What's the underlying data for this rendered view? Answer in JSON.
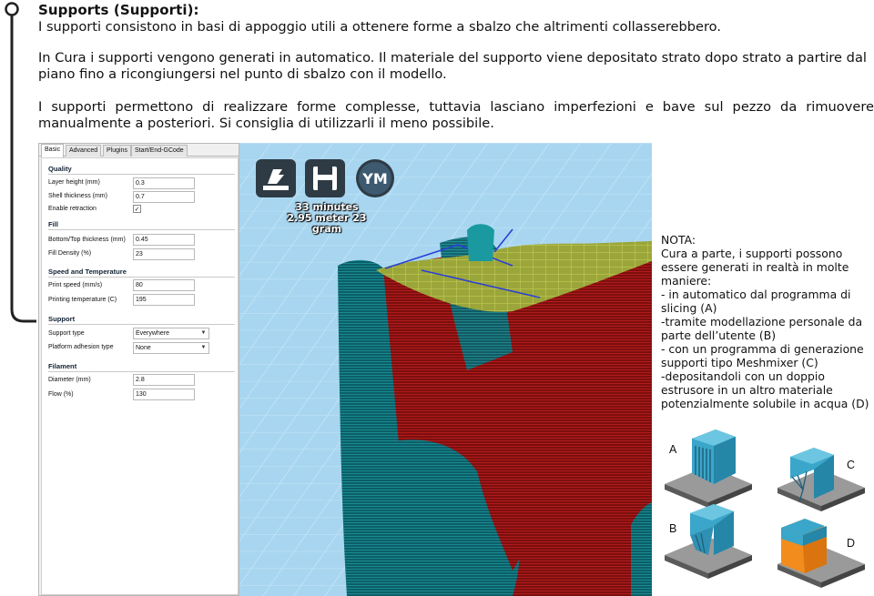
{
  "heading": "Supports (Supporti):",
  "paragraphs": [
    "I supporti consistono in basi di appoggio utili a ottenere forme a sbalzo che altrimenti collasserebbero.",
    "In Cura i supporti vengono generati in automatico. Il materiale del supporto viene depositato strato dopo strato a partire dal piano fino a ricongiungersi nel punto di sbalzo con il modello.",
    "I supporti permettono di realizzare forme complesse, tuttavia lasciano imperfezioni e bave sul pezzo da rimuovere manualmente a posteriori. Si consiglia di utilizzarli il meno possibile."
  ],
  "cura": {
    "tabs": [
      "Basic",
      "Advanced",
      "Plugins",
      "Start/End-GCode"
    ],
    "active_tab": "Basic",
    "sections": {
      "quality": "Quality",
      "fill": "Fill",
      "speed": "Speed and Temperature",
      "support": "Support",
      "filament": "Filament"
    },
    "fields": {
      "layer_height": {
        "label": "Layer height (mm)",
        "value": "0.3"
      },
      "shell_thickness": {
        "label": "Shell thickness (mm)",
        "value": "0.7"
      },
      "enable_retraction": {
        "label": "Enable retraction",
        "checked": "✓"
      },
      "bottom_top": {
        "label": "Bottom/Top thickness (mm)",
        "value": "0.45"
      },
      "fill_density": {
        "label": "Fill Density (%)",
        "value": "23"
      },
      "print_speed": {
        "label": "Print speed (mm/s)",
        "value": "80"
      },
      "print_temp": {
        "label": "Printing temperature (C)",
        "value": "195"
      },
      "support_type": {
        "label": "Support type",
        "value": "Everywhere"
      },
      "adhesion": {
        "label": "Platform adhesion type",
        "value": "None"
      },
      "diameter": {
        "label": "Diameter (mm)",
        "value": "2.8"
      },
      "flow": {
        "label": "Flow (%)",
        "value": "130"
      }
    }
  },
  "viewport": {
    "toolbar_icons": [
      "load-model-icon",
      "save-icon",
      "youmagine-icon"
    ],
    "ym_label": "YM",
    "time_line1": "33 minutes",
    "time_line2": "2.95 meter 23 gram"
  },
  "note": {
    "lines": [
      "NOTA:",
      "Cura a parte, i supporti possono",
      "essere generati in realtà in molte",
      "maniere:",
      "- in automatico dal programma di",
      "slicing (A)",
      "-tramite modellazione personale da",
      "parte dell’utente (B)",
      "- con un programma di generazione",
      "supporti tipo Meshmixer (C)",
      "-depositandoli con un doppio",
      "estrusore in un altro materiale",
      "potenzialmente solubile in acqua (D)"
    ]
  },
  "illustration": {
    "labels": [
      "A",
      "B",
      "C",
      "D"
    ],
    "colors": {
      "model": "#3aa6c9",
      "base": "#5a5a5a",
      "soluble": "#f28c1c"
    }
  },
  "colors": {
    "viewport_bg": "#a8d6f0",
    "model_red": "#8a1010",
    "support_teal": "#0e6f78",
    "toolbar_dark": "#2f3b44"
  }
}
